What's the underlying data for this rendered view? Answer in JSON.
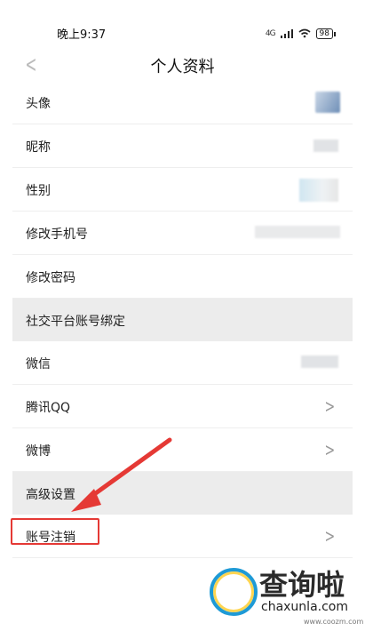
{
  "status_bar": {
    "time": "晚上9:37",
    "signal": "4G",
    "battery": "98"
  },
  "nav": {
    "title": "个人资料"
  },
  "rows": [
    {
      "label": "头像"
    },
    {
      "label": "昵称"
    },
    {
      "label": "性别"
    },
    {
      "label": "修改手机号"
    },
    {
      "label": "修改密码"
    },
    {
      "label": "社交平台账号绑定"
    },
    {
      "label": "微信"
    },
    {
      "label": "腾讯QQ"
    },
    {
      "label": "微博"
    },
    {
      "label": "高级设置"
    },
    {
      "label": "账号注销"
    }
  ],
  "annotation_color": "#e53935",
  "watermark": {
    "brand": "查询啦",
    "url": "chaxunla.com",
    "small_url": "www.coozm.com"
  }
}
